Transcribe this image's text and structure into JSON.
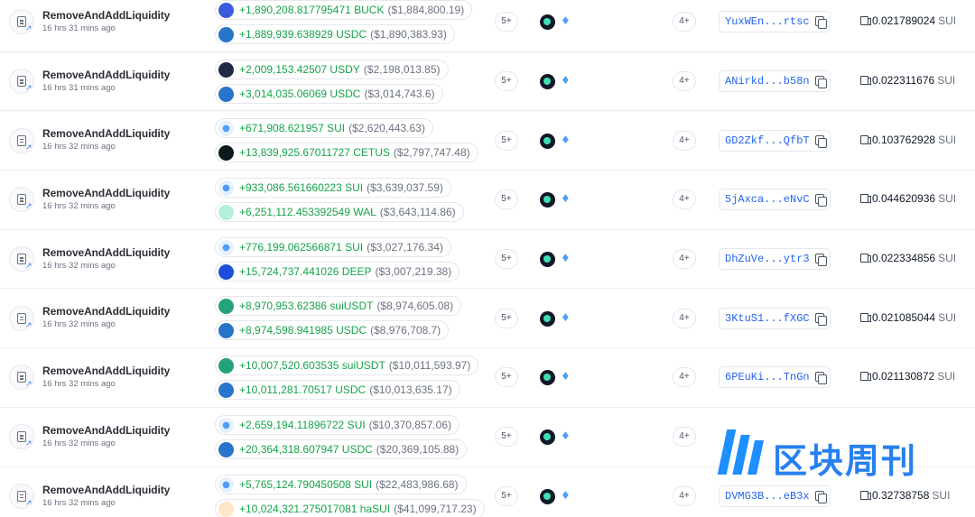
{
  "rows": [
    {
      "name": "RemoveAndAddLiquidity",
      "time": "16 hrs 31 mins ago",
      "changes": [
        {
          "coin": "BUCK",
          "icon": "buck-icon",
          "color": "#3b5bdb",
          "glyph": "B",
          "amount": "+1,890,208.817795471 BUCK",
          "usd": "($1,884,800.19)"
        },
        {
          "coin": "USDC",
          "icon": "usdc-icon",
          "color": "#2775ca",
          "glyph": "$",
          "amount": "+1,889,939.638929 USDC",
          "usd": "($1,890,383.93)"
        }
      ],
      "count1": "5+",
      "count2": "4+",
      "digest": "YuxWEn...rtsc",
      "fee": "0.021789024",
      "fee_unit": "SUI"
    },
    {
      "name": "RemoveAndAddLiquidity",
      "time": "16 hrs 31 mins ago",
      "changes": [
        {
          "coin": "USDY",
          "icon": "usdy-icon",
          "color": "#1f2a44",
          "glyph": "Y",
          "amount": "+2,009,153.42507 USDY",
          "usd": "($2,198,013.85)"
        },
        {
          "coin": "USDC",
          "icon": "usdc-icon",
          "color": "#2775ca",
          "glyph": "$",
          "amount": "+3,014,035.06069 USDC",
          "usd": "($3,014,743.6)"
        }
      ],
      "count1": "5+",
      "count2": "4+",
      "digest": "ANirkd...b58n",
      "fee": "0.022311676",
      "fee_unit": "SUI"
    },
    {
      "name": "RemoveAndAddLiquidity",
      "time": "16 hrs 32 mins ago",
      "changes": [
        {
          "coin": "SUI",
          "icon": "sui-icon",
          "color": "#e6f1fe",
          "glyph": "💧",
          "amount": "+671,908.621957 SUI",
          "usd": "($2,620,443.63)"
        },
        {
          "coin": "CETUS",
          "icon": "cetus-icon",
          "color": "#0b1a1a",
          "glyph": "C",
          "amount": "+13,839,925.67011727 CETUS",
          "usd": "($2,797,747.48)"
        }
      ],
      "count1": "5+",
      "count2": "4+",
      "digest": "GD2Zkf...QfbT",
      "fee": "0.103762928",
      "fee_unit": "SUI"
    },
    {
      "name": "RemoveAndAddLiquidity",
      "time": "16 hrs 32 mins ago",
      "changes": [
        {
          "coin": "SUI",
          "icon": "sui-icon",
          "color": "#e6f1fe",
          "glyph": "💧",
          "amount": "+933,086.561660223 SUI",
          "usd": "($3,639,037.59)"
        },
        {
          "coin": "WAL",
          "icon": "wal-icon",
          "color": "#b5f0df",
          "glyph": "W",
          "amount": "+6,251,112.453392549 WAL",
          "usd": "($3,643,114.86)"
        }
      ],
      "count1": "5+",
      "count2": "4+",
      "digest": "5jAxca...eNvC",
      "fee": "0.044620936",
      "fee_unit": "SUI"
    },
    {
      "name": "RemoveAndAddLiquidity",
      "time": "16 hrs 32 mins ago",
      "changes": [
        {
          "coin": "SUI",
          "icon": "sui-icon",
          "color": "#e6f1fe",
          "glyph": "💧",
          "amount": "+776,199.062566871 SUI",
          "usd": "($3,027,176.34)"
        },
        {
          "coin": "DEEP",
          "icon": "deep-icon",
          "color": "#1d4ed8",
          "glyph": "D",
          "amount": "+15,724,737.441026 DEEP",
          "usd": "($3,007,219.38)"
        }
      ],
      "count1": "5+",
      "count2": "4+",
      "digest": "DhZuVe...ytr3",
      "fee": "0.022334856",
      "fee_unit": "SUI"
    },
    {
      "name": "RemoveAndAddLiquidity",
      "time": "16 hrs 32 mins ago",
      "changes": [
        {
          "coin": "suiUSDT",
          "icon": "usdt-icon",
          "color": "#26a17b",
          "glyph": "T",
          "amount": "+8,970,953.62386 suiUSDT",
          "usd": "($8,974,605.08)"
        },
        {
          "coin": "USDC",
          "icon": "usdc-icon",
          "color": "#2775ca",
          "glyph": "$",
          "amount": "+8,974,598.941985 USDC",
          "usd": "($8,976,708.7)"
        }
      ],
      "count1": "5+",
      "count2": "4+",
      "digest": "3KtuS1...fXGC",
      "fee": "0.021085044",
      "fee_unit": "SUI"
    },
    {
      "name": "RemoveAndAddLiquidity",
      "time": "16 hrs 32 mins ago",
      "changes": [
        {
          "coin": "suiUSDT",
          "icon": "usdt-icon",
          "color": "#26a17b",
          "glyph": "T",
          "amount": "+10,007,520.603535 suiUSDT",
          "usd": "($10,011,593.97)"
        },
        {
          "coin": "USDC",
          "icon": "usdc-icon",
          "color": "#2775ca",
          "glyph": "$",
          "amount": "+10,011,281.70517 USDC",
          "usd": "($10,013,635.17)"
        }
      ],
      "count1": "5+",
      "count2": "4+",
      "digest": "6PEuKi...TnGn",
      "fee": "0.021130872",
      "fee_unit": "SUI"
    },
    {
      "name": "RemoveAndAddLiquidity",
      "time": "16 hrs 32 mins ago",
      "changes": [
        {
          "coin": "SUI",
          "icon": "sui-icon",
          "color": "#e6f1fe",
          "glyph": "💧",
          "amount": "+2,659,194.11896722 SUI",
          "usd": "($10,370,857.06)"
        },
        {
          "coin": "USDC",
          "icon": "usdc-icon",
          "color": "#2775ca",
          "glyph": "$",
          "amount": "+20,364,318.607947 USDC",
          "usd": "($20,369,105.88)"
        }
      ],
      "count1": "5+",
      "count2": "4+",
      "digest": "",
      "fee": "",
      "fee_unit": ""
    },
    {
      "name": "RemoveAndAddLiquidity",
      "time": "16 hrs 32 mins ago",
      "changes": [
        {
          "coin": "SUI",
          "icon": "sui-icon",
          "color": "#e6f1fe",
          "glyph": "💧",
          "amount": "+5,765,124.790450508 SUI",
          "usd": "($22,483,986.68)"
        },
        {
          "coin": "haSUI",
          "icon": "hasui-icon",
          "color": "#fde7c8",
          "glyph": "h",
          "amount": "+10,024,321.275017081 haSUI",
          "usd": "($41,099,717.23)"
        }
      ],
      "count1": "5+",
      "count2": "4+",
      "digest": "DVMG3B...eB3x",
      "fee": "0.32738758",
      "fee_unit": "SUI"
    }
  ],
  "watermark": {
    "text": "区块周刊"
  },
  "colors": {
    "positive": "#16a34a",
    "link": "#2563eb",
    "muted": "#6b7280"
  }
}
